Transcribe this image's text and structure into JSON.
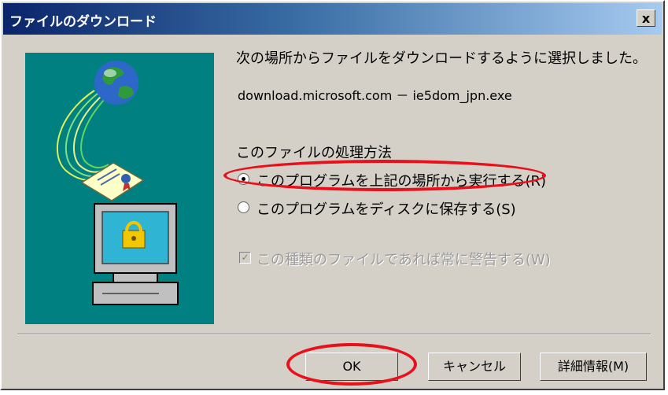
{
  "window": {
    "title": "ファイルのダウンロード",
    "close_label": "x"
  },
  "prompt": "次の場所からファイルをダウンロードするように選択しました。",
  "file_source": "download.microsoft.com － ie5dom_jpn.exe",
  "group_label": "このファイルの処理方法",
  "options": [
    {
      "label": "このプログラムを上記の場所から実行する(R)",
      "selected": true
    },
    {
      "label": "このプログラムをディスクに保存する(S)",
      "selected": false
    }
  ],
  "checkbox": {
    "label": "この種類のファイルであれば常に警告する(W)",
    "checked": true,
    "enabled": false
  },
  "buttons": {
    "ok": "OK",
    "cancel": "キャンセル",
    "details": "詳細情報(M)"
  },
  "illustration": {
    "icons": [
      "globe-icon",
      "certificate-icon",
      "computer-lock-icon"
    ]
  },
  "colors": {
    "annotation": "#e8101a",
    "illustration_bg": "#008080"
  }
}
